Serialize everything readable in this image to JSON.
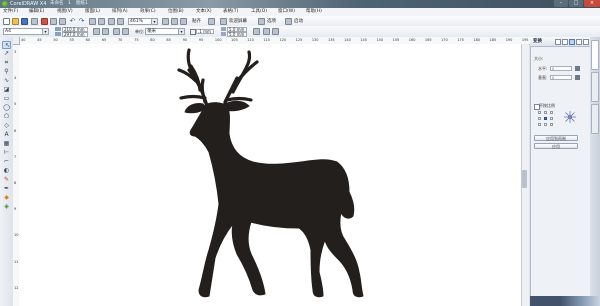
{
  "window": {
    "title": "CorelDRAW X4",
    "extra_title_texts": [
      "未命名",
      "1",
      "图纸1"
    ]
  },
  "menu": {
    "items": [
      "文件(F)",
      "编辑(E)",
      "视图(V)",
      "版面(L)",
      "排列(A)",
      "效果(C)",
      "位图(B)",
      "文本(X)",
      "表格(T)",
      "工具(O)",
      "窗口(W)",
      "帮助(H)"
    ]
  },
  "toolbar": {
    "zoom": "461%",
    "snap_label": "贴齐",
    "welcome_label": "欢迎屏幕",
    "options_label": "选项",
    "launch_label": "启动"
  },
  "propbar": {
    "page_size": "A4",
    "width_value": "210.0 mm",
    "height_value": "297.0 mm",
    "units_label": "单位:",
    "units_value": "毫米",
    "nudge_value": ".1 mm",
    "dup_x": "5.0 mm",
    "dup_y": "5.0 mm"
  },
  "ruler": {
    "top_ticks": [
      "40",
      "45",
      "50",
      "55",
      "60",
      "65",
      "70",
      "75",
      "80",
      "85",
      "90",
      "95",
      "100",
      "105",
      "110",
      "115",
      "120",
      "125",
      "130",
      "135",
      "140",
      "145",
      "150",
      "155",
      "160",
      "165",
      "170",
      "175",
      "180",
      "185",
      "190",
      "195"
    ],
    "left_ticks": [
      "3",
      "4",
      "5",
      "6",
      "7",
      "8",
      "9",
      "10",
      "11",
      "12"
    ]
  },
  "docker": {
    "title": "变换",
    "section_label": "大小:",
    "w_label": "水平:",
    "h_label": "垂直:",
    "w_value": "0",
    "h_value": "0",
    "proportional_label": "不按比例",
    "apply_copy_label": "应用到再制",
    "apply_label": "应用"
  },
  "colors": {
    "accent": "#3f6fb3",
    "silhouette": "#231f1c",
    "titlebar": "#5f7584"
  }
}
